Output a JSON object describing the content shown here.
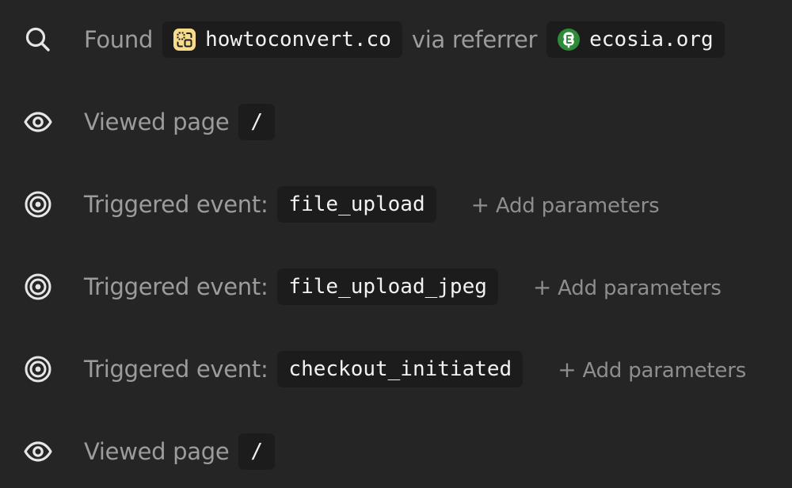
{
  "timeline": {
    "events": [
      {
        "type": "found",
        "icon": "search-icon",
        "label": "Found",
        "site": "howtoconvert.co",
        "site_icon": "howtoconvert-favicon",
        "via_label": "via referrer",
        "referrer": "ecosia.org",
        "referrer_icon": "ecosia-favicon"
      },
      {
        "type": "pageview",
        "icon": "eye-icon",
        "label": "Viewed page",
        "path": "/"
      },
      {
        "type": "event",
        "icon": "target-icon",
        "label": "Triggered event:",
        "event_name": "file_upload",
        "add_params_plus": "+",
        "add_params_label": "Add parameters"
      },
      {
        "type": "event",
        "icon": "target-icon",
        "label": "Triggered event:",
        "event_name": "file_upload_jpeg",
        "add_params_plus": "+",
        "add_params_label": "Add parameters"
      },
      {
        "type": "event",
        "icon": "target-icon",
        "label": "Triggered event:",
        "event_name": "checkout_initiated",
        "add_params_plus": "+",
        "add_params_label": "Add parameters"
      },
      {
        "type": "pageview",
        "icon": "eye-icon",
        "label": "Viewed page",
        "path": "/"
      }
    ]
  },
  "colors": {
    "background": "#252525",
    "chip_background": "#1c1c1c",
    "label_text": "#9c9c9c",
    "chip_text": "#f2f2f2",
    "icon_stroke": "#e6e6e6",
    "howtoconvert_favicon": "#f7dc8b",
    "ecosia_favicon": "#2f8a3a"
  }
}
